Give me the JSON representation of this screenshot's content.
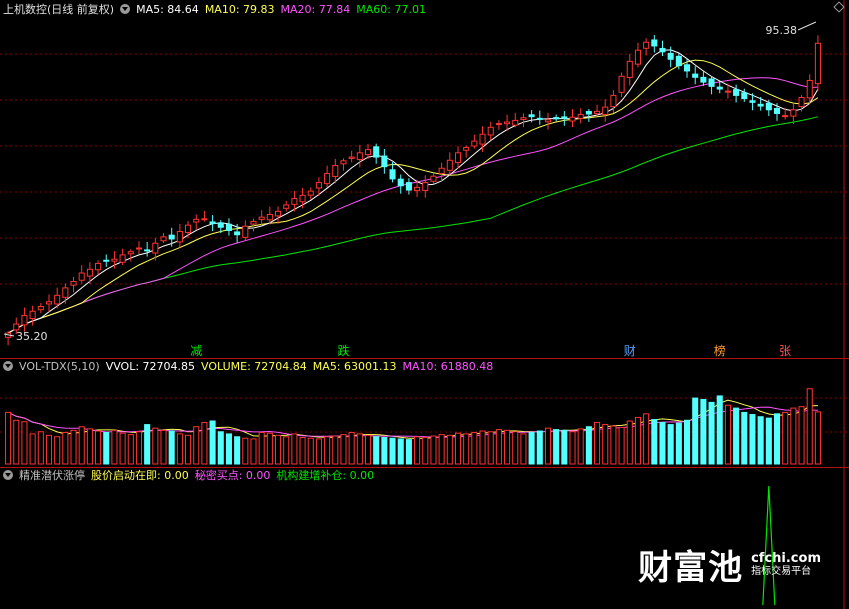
{
  "header": {
    "title": "上机数控(日线 前复权)",
    "ma5": "MA5: 84.64",
    "ma10": "MA10: 79.83",
    "ma20": "MA20: 77.84",
    "ma60": "MA60: 77.01"
  },
  "price_labels": {
    "high": "95.38",
    "low": "35.20"
  },
  "event_markers": [
    "减",
    "跌",
    "财",
    "榜",
    "张"
  ],
  "volume_header": {
    "name": "VOL-TDX(5,10)",
    "vvol": "VVOL: 72704.85",
    "volume": "VOLUME: 72704.84",
    "ma5": "MA5: 63001.13",
    "ma10": "MA10: 61880.48"
  },
  "indicator_header": {
    "name": "精准潜伏涨停",
    "s1": "股价启动在即: 0.00",
    "s2": "秘密买点: 0.00",
    "s3": "机构建增补仓: 0.00"
  },
  "watermark": {
    "logo": "财富池",
    "site": "cfchi.com",
    "slogan": "指标交易平台"
  },
  "colors": {
    "up": "#ff3333",
    "down": "#54ffff",
    "ma5": "#ffffff",
    "ma10": "#ffff54",
    "ma20": "#ff54ff",
    "ma60": "#00e600",
    "grid": "#8b0000"
  },
  "chart_data": {
    "type": "candlestick",
    "price_range": [
      35.2,
      95.38
    ],
    "close": [
      36.5,
      38.2,
      39.8,
      40.6,
      41.5,
      42.4,
      43.6,
      45.0,
      46.2,
      47.8,
      48.5,
      49.6,
      50.1,
      50.4,
      51.2,
      51.8,
      52.5,
      52.0,
      53.4,
      54.6,
      54.2,
      55.6,
      56.8,
      57.9,
      58.0,
      57.1,
      56.4,
      55.8,
      55.0,
      56.6,
      57.5,
      58.3,
      58.8,
      59.4,
      60.6,
      61.8,
      62.4,
      63.2,
      64.8,
      66.5,
      68.0,
      68.9,
      69.6,
      70.4,
      71.0,
      69.6,
      67.8,
      65.5,
      64.2,
      63.4,
      63.9,
      64.8,
      66.0,
      67.5,
      69.0,
      70.4,
      71.4,
      72.6,
      73.9,
      75.2,
      75.9,
      76.2,
      76.5,
      77.0,
      77.2,
      76.7,
      76.6,
      76.8,
      76.9,
      77.1,
      77.6,
      77.7,
      78.2,
      79.0,
      81.2,
      84.8,
      87.6,
      89.7,
      91.2,
      90.5,
      89.4,
      88.0,
      86.8,
      85.8,
      84.6,
      83.7,
      82.9,
      82.4,
      82.0,
      81.2,
      80.6,
      79.9,
      79.2,
      78.5,
      77.8,
      77.4,
      78.5,
      80.8,
      84.0,
      91.0
    ],
    "volume_range": [
      0,
      120000
    ],
    "volume": [
      72000,
      61000,
      59000,
      42000,
      45000,
      40000,
      38000,
      44000,
      47000,
      52000,
      49000,
      46000,
      44000,
      47000,
      43000,
      41000,
      45000,
      55000,
      50000,
      47000,
      46000,
      42000,
      40000,
      52000,
      58000,
      60000,
      45000,
      42000,
      38000,
      36000,
      35000,
      44000,
      43000,
      40000,
      38000,
      42000,
      37000,
      36000,
      35000,
      38000,
      39000,
      41000,
      44000,
      42000,
      40000,
      38000,
      37000,
      36000,
      35000,
      34000,
      38000,
      37000,
      39000,
      41000,
      40000,
      43000,
      42000,
      44000,
      46000,
      45000,
      48000,
      47000,
      45000,
      42000,
      44000,
      46000,
      50000,
      48000,
      47000,
      45000,
      49000,
      52000,
      58000,
      55000,
      53000,
      51000,
      60000,
      65000,
      70000,
      62000,
      58000,
      55000,
      57000,
      61000,
      92000,
      90000,
      86000,
      95000,
      82000,
      78000,
      72000,
      69000,
      66000,
      64000,
      70000,
      72000,
      78000,
      80000,
      105000,
      72705
    ],
    "indicator_signal": {
      "value": 0,
      "spike_position": "near right end"
    }
  }
}
